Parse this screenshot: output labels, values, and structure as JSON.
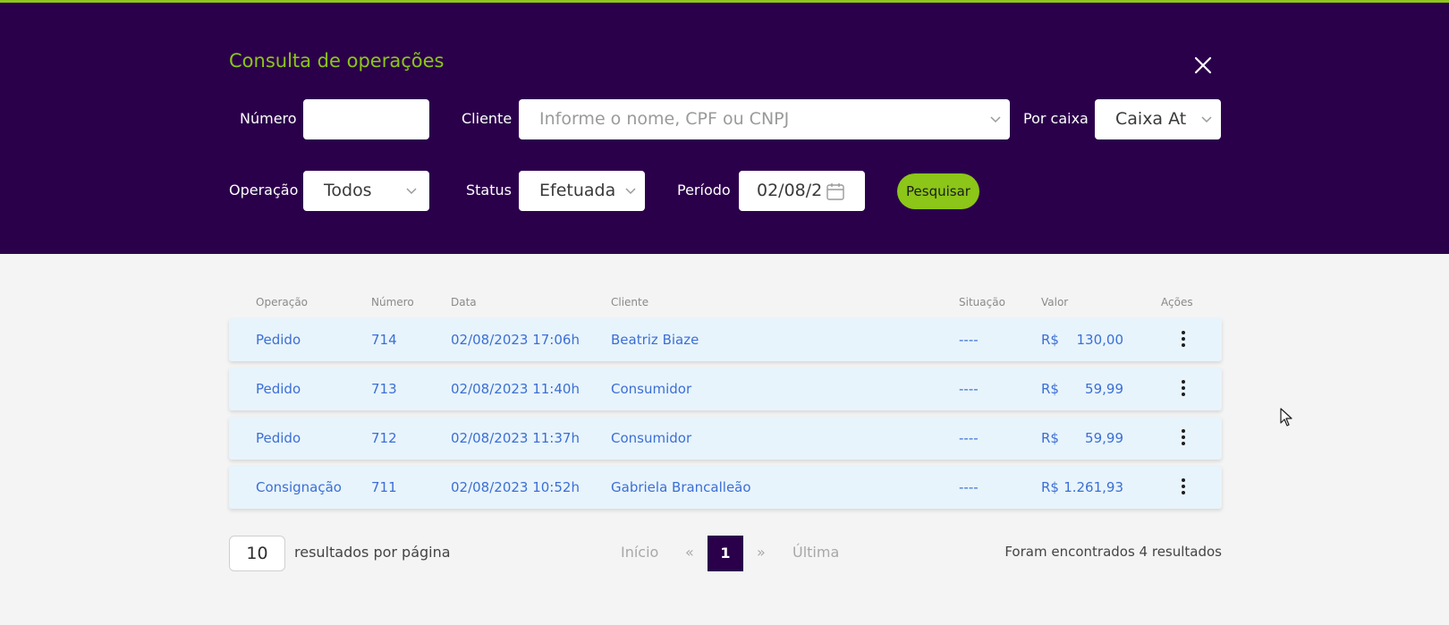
{
  "header": {
    "title": "Consulta de operações",
    "accent_color": "#8cc618",
    "background_color": "#2b004b"
  },
  "filters": {
    "numero_label": "Número",
    "numero_value": "",
    "cliente_label": "Cliente",
    "cliente_placeholder": "Informe o nome, CPF ou CNPJ",
    "caixa_label": "Por caixa",
    "caixa_value": "Caixa At",
    "operacao_label": "Operação",
    "operacao_value": "Todos",
    "status_label": "Status",
    "status_value": "Efetuada",
    "periodo_label": "Período",
    "periodo_value": "02/08/2",
    "search_label": "Pesquisar"
  },
  "table": {
    "columns": [
      "Operação",
      "Número",
      "Data",
      "Cliente",
      "Situação",
      "Valor",
      "Ações"
    ],
    "rows": [
      {
        "operacao": "Pedido",
        "numero": "714",
        "data": "02/08/2023 17:06h",
        "cliente": "Beatriz Biaze",
        "situacao": "----",
        "moeda": "R$",
        "valor": "130,00"
      },
      {
        "operacao": "Pedido",
        "numero": "713",
        "data": "02/08/2023 11:40h",
        "cliente": "Consumidor",
        "situacao": "----",
        "moeda": "R$",
        "valor": "59,99"
      },
      {
        "operacao": "Pedido",
        "numero": "712",
        "data": "02/08/2023 11:37h",
        "cliente": "Consumidor",
        "situacao": "----",
        "moeda": "R$",
        "valor": "59,99"
      },
      {
        "operacao": "Consignação",
        "numero": "711",
        "data": "02/08/2023 10:52h",
        "cliente": "Gabriela Brancalleão",
        "situacao": "----",
        "moeda": "R$",
        "valor": "1.261,93"
      }
    ]
  },
  "pagination": {
    "per_page": "10",
    "per_page_label": "resultados por página",
    "first": "Início",
    "prev": "«",
    "current": "1",
    "next": "»",
    "last": "Última",
    "results_text": "Foram encontrados 4 resultados"
  }
}
